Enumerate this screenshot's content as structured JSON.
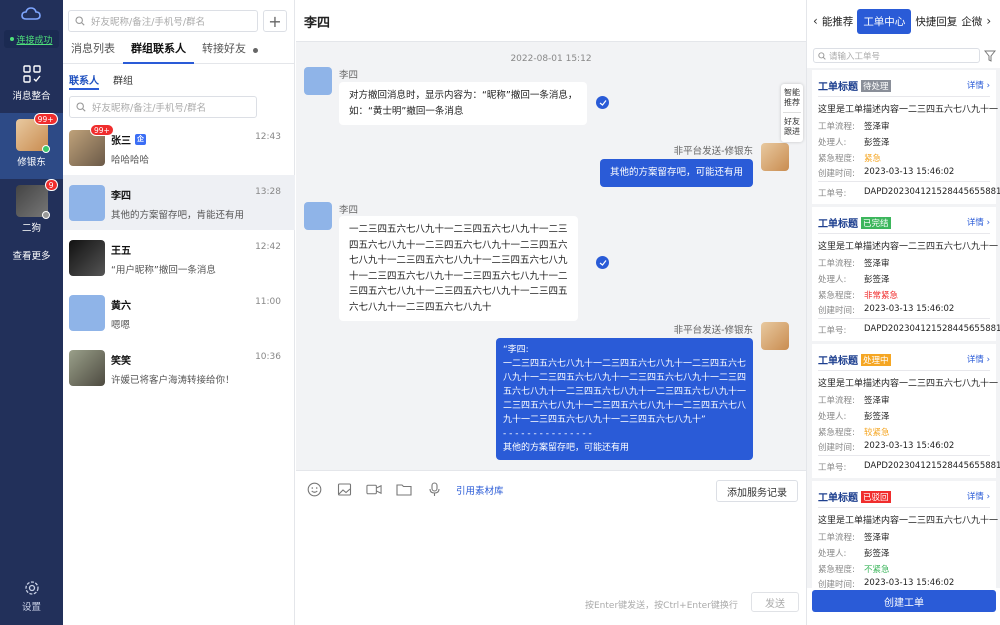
{
  "rail": {
    "connection_status": "连接成功",
    "nav_label": "消息整合",
    "accounts": [
      {
        "name": "修银东",
        "badge": "99+",
        "online": true
      },
      {
        "name": "二狗",
        "badge": "9",
        "online": false
      }
    ],
    "more_label": "查看更多",
    "settings_label": "设置"
  },
  "contacts": {
    "search_placeholder": "好友昵称/备注/手机号/群名",
    "tabs": [
      "消息列表",
      "群组联系人",
      "转接好友"
    ],
    "active_tab": 1,
    "subtabs": [
      "联系人",
      "群组"
    ],
    "sub_search_placeholder": "好友昵称/备注/手机号/群名",
    "items": [
      {
        "name": "张三",
        "tag": "企",
        "time": "12:43",
        "msg": "哈哈哈哈",
        "badge": "99+"
      },
      {
        "name": "李四",
        "time": "13:28",
        "msg": "其他的方案留存吧，肯能还有用"
      },
      {
        "name": "王五",
        "time": "12:42",
        "msg": "“用户昵称”撤回一条消息"
      },
      {
        "name": "黄六",
        "time": "11:00",
        "msg": "嗯嗯"
      },
      {
        "name": "笑笑",
        "time": "10:36",
        "msg": "许媛已将客户海涛转接给你！"
      }
    ]
  },
  "chat": {
    "title": "李四",
    "date": "2022-08-01  15:12",
    "float_tabs": [
      "智能\n推荐",
      "好友\n跟进"
    ],
    "messages": [
      {
        "sender": "李四",
        "text": "对方撤回消息时，显示内容为：“昵称”撤回一条消息，\n如：“黄士明”撤回一条消息"
      },
      {
        "sender": "非平台发送-修银东",
        "text": "其他的方案留存吧，可能还有用"
      },
      {
        "sender": "李四",
        "text": "一二三四五六七八九十一二三四五六七八九十一二三\n四五六七八九十一二三四五六七八九十一二三四五六\n七八九十一二三四五六七八九十一二三四五六七八九\n十一二三四五六七八九十一二三四五六七八九十一二\n三四五六七八九十一二三四五六七八九十一二三四五\n六七八九十一二三四五六七八九十"
      },
      {
        "sender": "非平台发送-修银东",
        "text": "“李四:\n一二三四五六七八九十一二三四五六七八九十一二三四五六七\n八九十一二三四五六七八九十一二三四五六七八九十一二三四\n五六七八九十一二三四五六七八九十一二三四五六七八九十一\n二三四五六七八九十一二三四五六七八九十一二三四五六七八\n九十一二三四五六七八九十一二三四五六七八九十”\n- - - - - - - - - - - - - - -\n其他的方案留存吧，可能还有用"
      }
    ],
    "quote_label": "引用素材库",
    "service_button": "添加服务记录",
    "hint": "按Enter键发送，按Ctrl+Enter键换行",
    "send_label": "发送"
  },
  "panel": {
    "tabs": [
      "能推荐",
      "工单中心",
      "快捷回复",
      "企微"
    ],
    "active_tab": 1,
    "search_placeholder": "请输入工单号",
    "field_labels": {
      "flow": "工单流程:",
      "handler": "处理人:",
      "urgency": "紧急程度:",
      "created": "创建时间:",
      "id": "工单号:"
    },
    "detail_label": "详情",
    "tickets": [
      {
        "title": "工单标题",
        "status": "待处理",
        "status_color": "#8a8f99",
        "desc": "这里是工单描述内容一二三四五六七八九十一",
        "flow": "签泽审",
        "handler": "彭签泽",
        "urgency": "紧急",
        "urgency_color": "#f5a623",
        "created": "2023-03-13 15:46:02",
        "id": "DAPD20230412152844565588​1"
      },
      {
        "title": "工单标题",
        "status": "已完结",
        "status_color": "#3cb65c",
        "desc": "这里是工单描述内容一二三四五六七八九十一",
        "flow": "签泽审",
        "handler": "彭签泽",
        "urgency": "非常紧急",
        "urgency_color": "#f02d2d",
        "created": "2023-03-13 15:46:02",
        "id": "DAPD20230412152844565588​1"
      },
      {
        "title": "工单标题",
        "status": "处理中",
        "status_color": "#f5a623",
        "desc": "这里是工单描述内容一二三四五六七八九十一",
        "flow": "签泽审",
        "handler": "彭签泽",
        "urgency": "较紧急",
        "urgency_color": "#f5a623",
        "created": "2023-03-13 15:46:02",
        "id": "DAPD20230412152844565588​1"
      },
      {
        "title": "工单标题",
        "status": "已驳回",
        "status_color": "#f02d2d",
        "desc": "这里是工单描述内容一二三四五六七八九十一",
        "flow": "签泽审",
        "handler": "彭签泽",
        "urgency": "不紧急",
        "urgency_color": "#3cb65c",
        "created": "2023-03-13 15:46:02",
        "id": "DAPD20230412152844565588​1"
      }
    ],
    "create_button": "创建工单"
  }
}
